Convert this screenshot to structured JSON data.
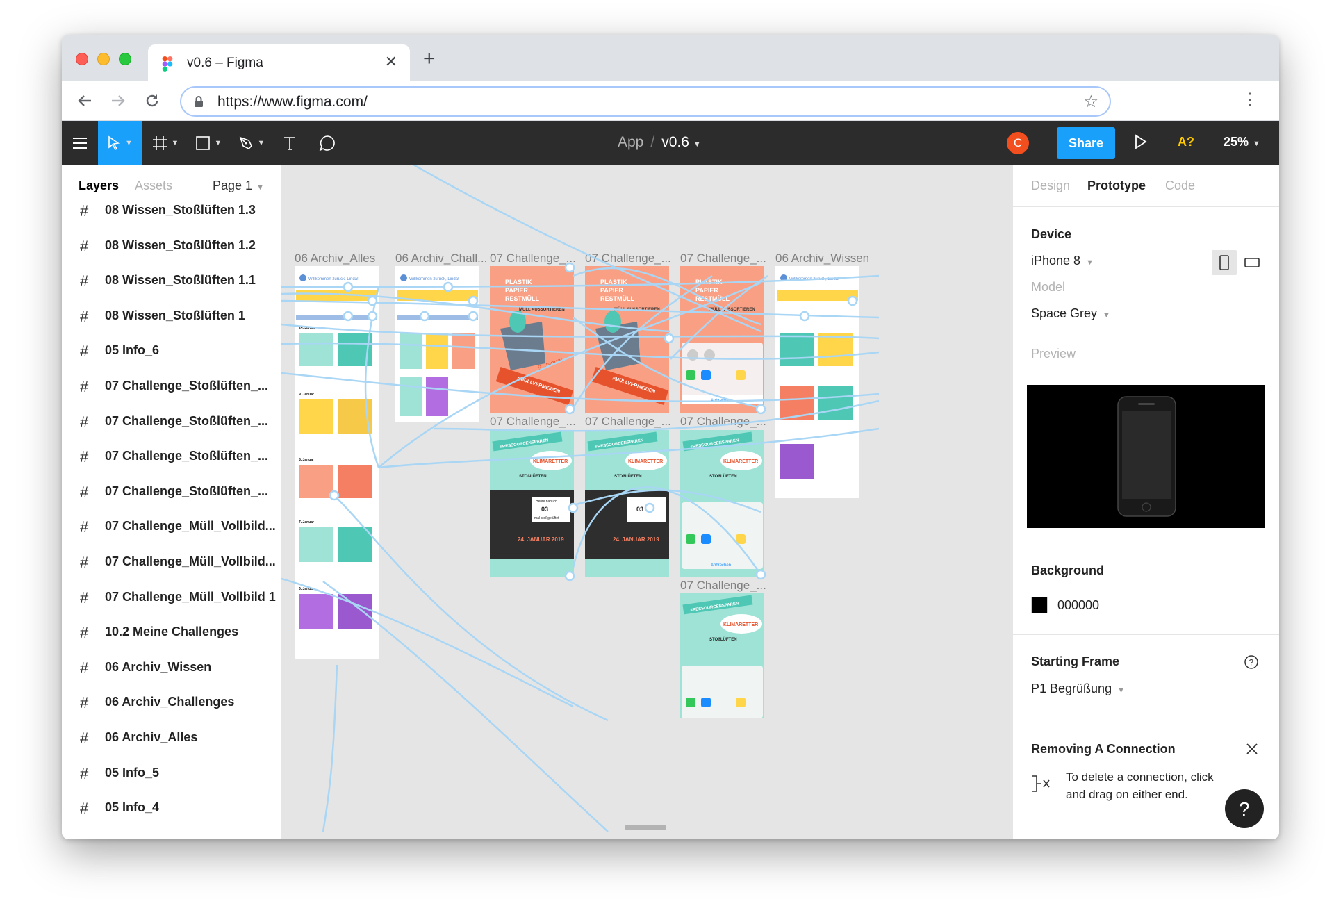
{
  "browser": {
    "tab_title": "v0.6 – Figma",
    "tab_close": "✕",
    "new_tab": "+",
    "url": "https://www.figma.com/"
  },
  "figma": {
    "breadcrumb_project": "App",
    "breadcrumb_sep": "/",
    "breadcrumb_file": "v0.6",
    "avatar_initial": "C",
    "share_label": "Share",
    "aq_label": "A?",
    "zoom_label": "25%"
  },
  "left_panel": {
    "tabs": {
      "layers": "Layers",
      "assets": "Assets",
      "page": "Page 1"
    },
    "layers": [
      "08 Wissen_Stoßlüften 1.3",
      "08 Wissen_Stoßlüften 1.2",
      "08 Wissen_Stoßlüften 1.1",
      "08 Wissen_Stoßlüften 1",
      "05 Info_6",
      "07 Challenge_Stoßlüften_...",
      "07 Challenge_Stoßlüften_...",
      "07 Challenge_Stoßlüften_...",
      "07 Challenge_Stoßlüften_...",
      "07 Challenge_Müll_Vollbild...",
      "07 Challenge_Müll_Vollbild...",
      "07 Challenge_Müll_Vollbild 1",
      "10.2 Meine Challenges",
      "06 Archiv_Wissen",
      "06 Archiv_Challenges",
      "06 Archiv_Alles",
      "05 Info_5",
      "05 Info_4"
    ]
  },
  "canvas": {
    "frame_labels": {
      "archiv_alles": "06 Archiv_Alles",
      "archiv_chall": "06 Archiv_Chall...",
      "challenge_1": "07 Challenge_...",
      "challenge_2": "07 Challenge_...",
      "challenge_3": "07 Challenge_...",
      "archiv_wissen": "06 Archiv_Wissen",
      "challenge_4": "07 Challenge_...",
      "challenge_5": "07 Challenge_...",
      "challenge_6": "07 Challenge_...",
      "challenge_7": "07 Challenge_..."
    },
    "app_greeting": "Willkommen zurück, Linda!",
    "poster_waste_lines": [
      "PLASTIK",
      "PAPIER",
      "RESTMÜLL"
    ],
    "poster_waste_task": "MÜLL AUSSORTIEREN",
    "poster_waste_tag": "#MÜLLVERMEIDEN",
    "poster_waste_date": "9. Januar",
    "poster_air_tag": "#RESSOURCENSPAREN",
    "poster_air_badge": "KLIMARETTER",
    "poster_air_task": "STOßLÜFTEN",
    "poster_air_counter_label": "Heute hab ich",
    "poster_air_counter": "03",
    "poster_air_counter_suffix": "mal stoßgelüftet",
    "poster_air_date": "24. JANUAR 2019",
    "share_cancel": "Abbrechen",
    "archiv_dates": [
      "24. Januar",
      "9. Januar",
      "8. Januar",
      "7. Januar",
      "6. Januar"
    ]
  },
  "right_panel": {
    "tabs": {
      "design": "Design",
      "prototype": "Prototype",
      "code": "Code"
    },
    "device_heading": "Device",
    "device_value": "iPhone 8",
    "model_label": "Model",
    "model_value": "Space Grey",
    "preview_label": "Preview",
    "background_heading": "Background",
    "background_value": "000000",
    "starting_frame_heading": "Starting Frame",
    "starting_frame_value": "P1 Begrüßung",
    "removing_heading": "Removing A Connection",
    "removing_text_1": "To delete a connection, click",
    "removing_text_2": "and drag on either end.",
    "help_label": "?"
  },
  "colors": {
    "figma_dark": "#2c2c2c",
    "figma_blue": "#18a0fb",
    "connection": "#a9d6f5",
    "poster_salmon": "#f9a084",
    "poster_teal": "#9fe3d6",
    "avatar": "#f24e1e"
  }
}
